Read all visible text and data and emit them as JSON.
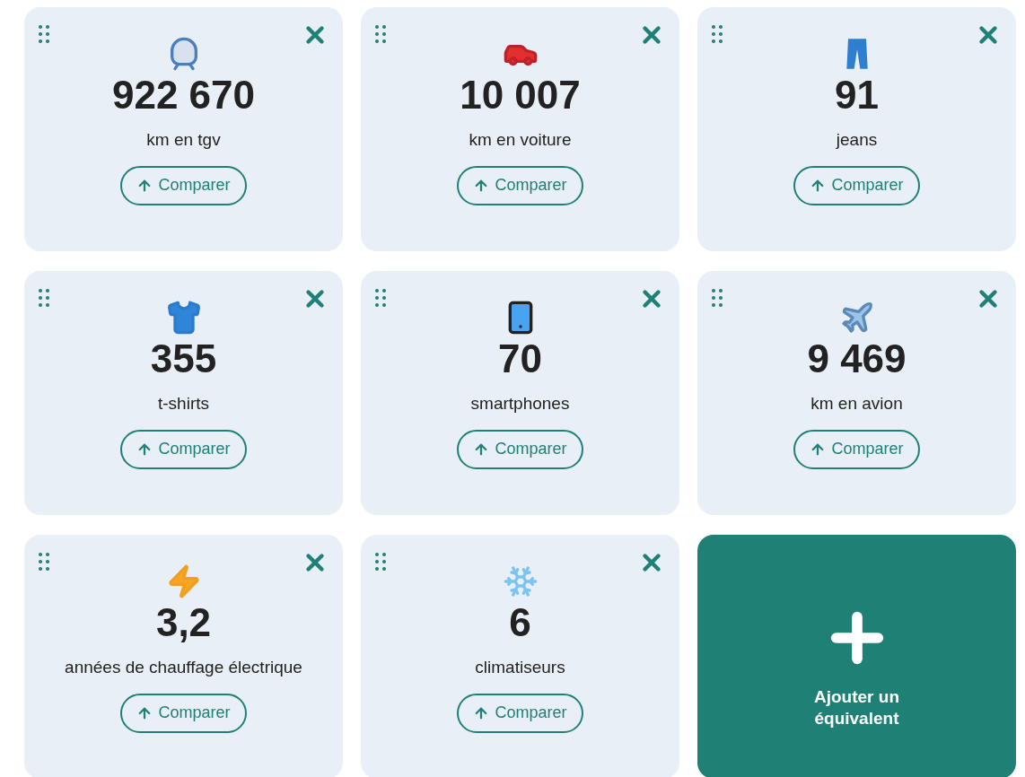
{
  "cards": [
    {
      "value": "922 670",
      "label": "km en tgv",
      "button": "Comparer"
    },
    {
      "value": "10 007",
      "label": "km en voiture",
      "button": "Comparer"
    },
    {
      "value": "91",
      "label": "jeans",
      "button": "Comparer"
    },
    {
      "value": "355",
      "label": "t-shirts",
      "button": "Comparer"
    },
    {
      "value": "70",
      "label": "smartphones",
      "button": "Comparer"
    },
    {
      "value": "9 469",
      "label": "km en avion",
      "button": "Comparer"
    },
    {
      "value": "3,2",
      "label": "années de chauffage électrique",
      "button": "Comparer"
    },
    {
      "value": "6",
      "label": "climatiseurs",
      "button": "Comparer"
    }
  ],
  "add_card": {
    "label": "Ajouter un équivalent"
  }
}
